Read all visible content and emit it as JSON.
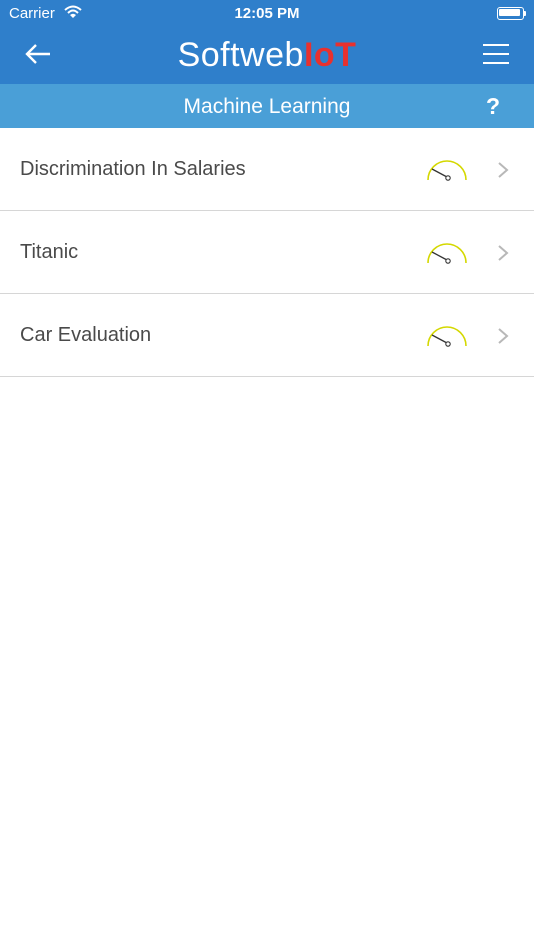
{
  "status_bar": {
    "carrier": "Carrier",
    "time": "12:05 PM",
    "battery_level": 1.0
  },
  "header": {
    "brand_part1": "Softweb",
    "brand_part2": "IoT",
    "brand_part2_color": "#e8312f",
    "back_icon": "arrow-left-icon",
    "menu_icon": "hamburger-menu-icon",
    "background": "#2f7fcb"
  },
  "subheader": {
    "title": "Machine Learning",
    "help_label": "?",
    "background": "#4a9fd7"
  },
  "items": [
    {
      "label": "Discrimination In Salaries",
      "icon": "gauge-icon"
    },
    {
      "label": "Titanic",
      "icon": "gauge-icon"
    },
    {
      "label": "Car Evaluation",
      "icon": "gauge-icon"
    }
  ]
}
